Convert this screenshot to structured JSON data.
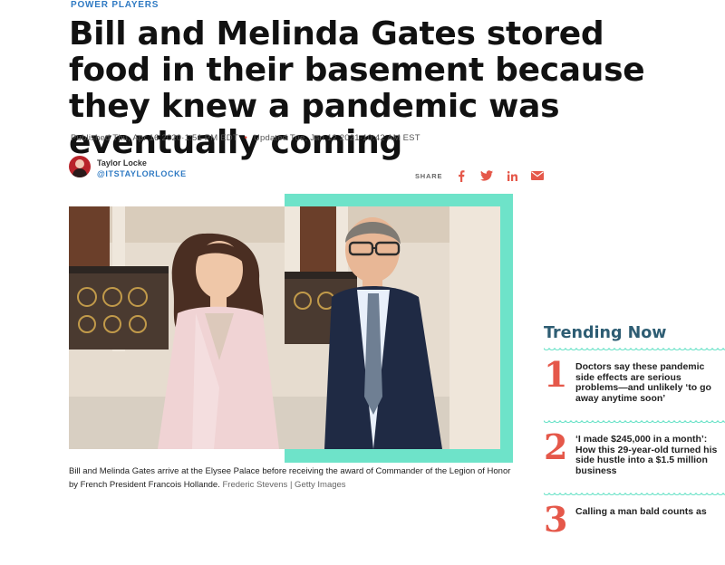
{
  "article": {
    "kicker": "POWER PLAYERS",
    "headline": "Bill and Melinda Gates stored food in their basement because they knew a pandemic was eventually coming",
    "published": "Published Thu, Apr 16 2020·1:51 PM EDT",
    "updated": "Updated Tue, Jan 12 2021·10:42 AM EST",
    "date_separator": "•"
  },
  "author": {
    "name": "Taylor Locke",
    "handle": "@ITSTAYLORLOCKE"
  },
  "share": {
    "label": "SHARE",
    "icons": [
      "facebook-icon",
      "twitter-icon",
      "linkedin-icon",
      "email-icon"
    ]
  },
  "image": {
    "caption": "Bill and Melinda Gates arrive at the Elysee Palace before receiving the award of Commander of the Legion of Honor by French President Francois Hollande.",
    "credit": "Frederic Stevens | Getty Images"
  },
  "trending": {
    "title": "Trending Now",
    "items": [
      {
        "number": "1",
        "text": "Doctors say these pandemic side effects are serious problems—and unlikely ‘to go away anytime soon’"
      },
      {
        "number": "2",
        "text": "‘I made $245,000 in a month’: How this 29-year-old turned his side hustle into a $1.5 million business"
      },
      {
        "number": "3",
        "text": "Calling a man bald counts as"
      }
    ]
  },
  "colors": {
    "accent_blue": "#2f7ac3",
    "teal": "#6ee3c9",
    "trending_number": "#e5584a",
    "trending_title": "#2e5d73",
    "social_icon": "#e5584a"
  }
}
